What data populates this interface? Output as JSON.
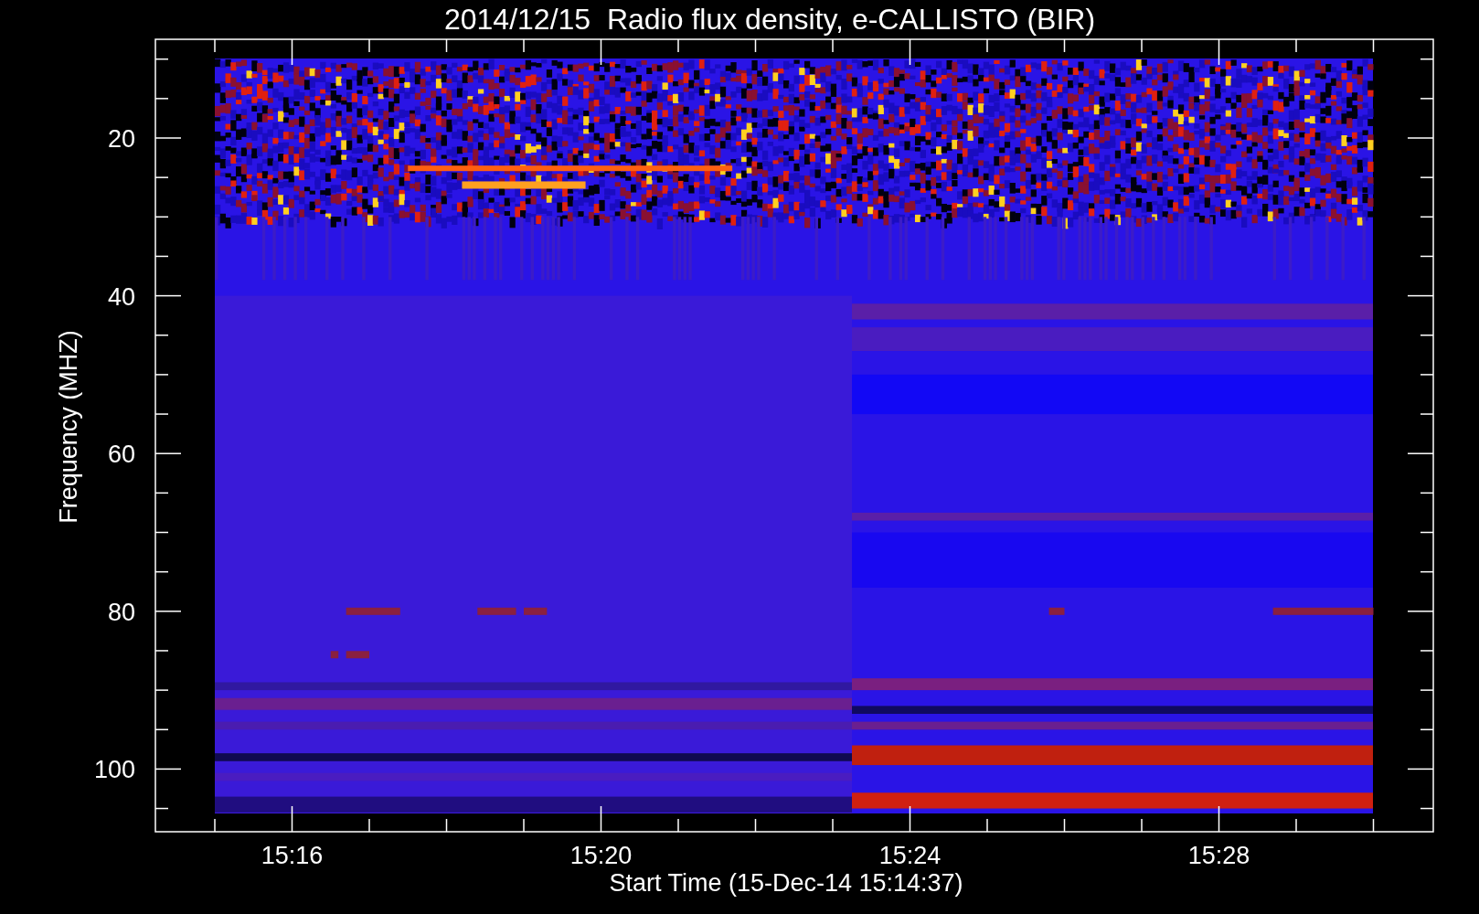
{
  "title": "2014/12/15  Radio flux density, e-CALLISTO (BIR)",
  "y_axis": {
    "label": "Frequency (MHZ)",
    "tick_labels": [
      "20",
      "40",
      "60",
      "80",
      "100"
    ]
  },
  "x_axis": {
    "label": "Start Time (15-Dec-14 15:14:37)",
    "tick_labels": [
      "15:16",
      "15:20",
      "15:24",
      "15:28"
    ]
  }
}
